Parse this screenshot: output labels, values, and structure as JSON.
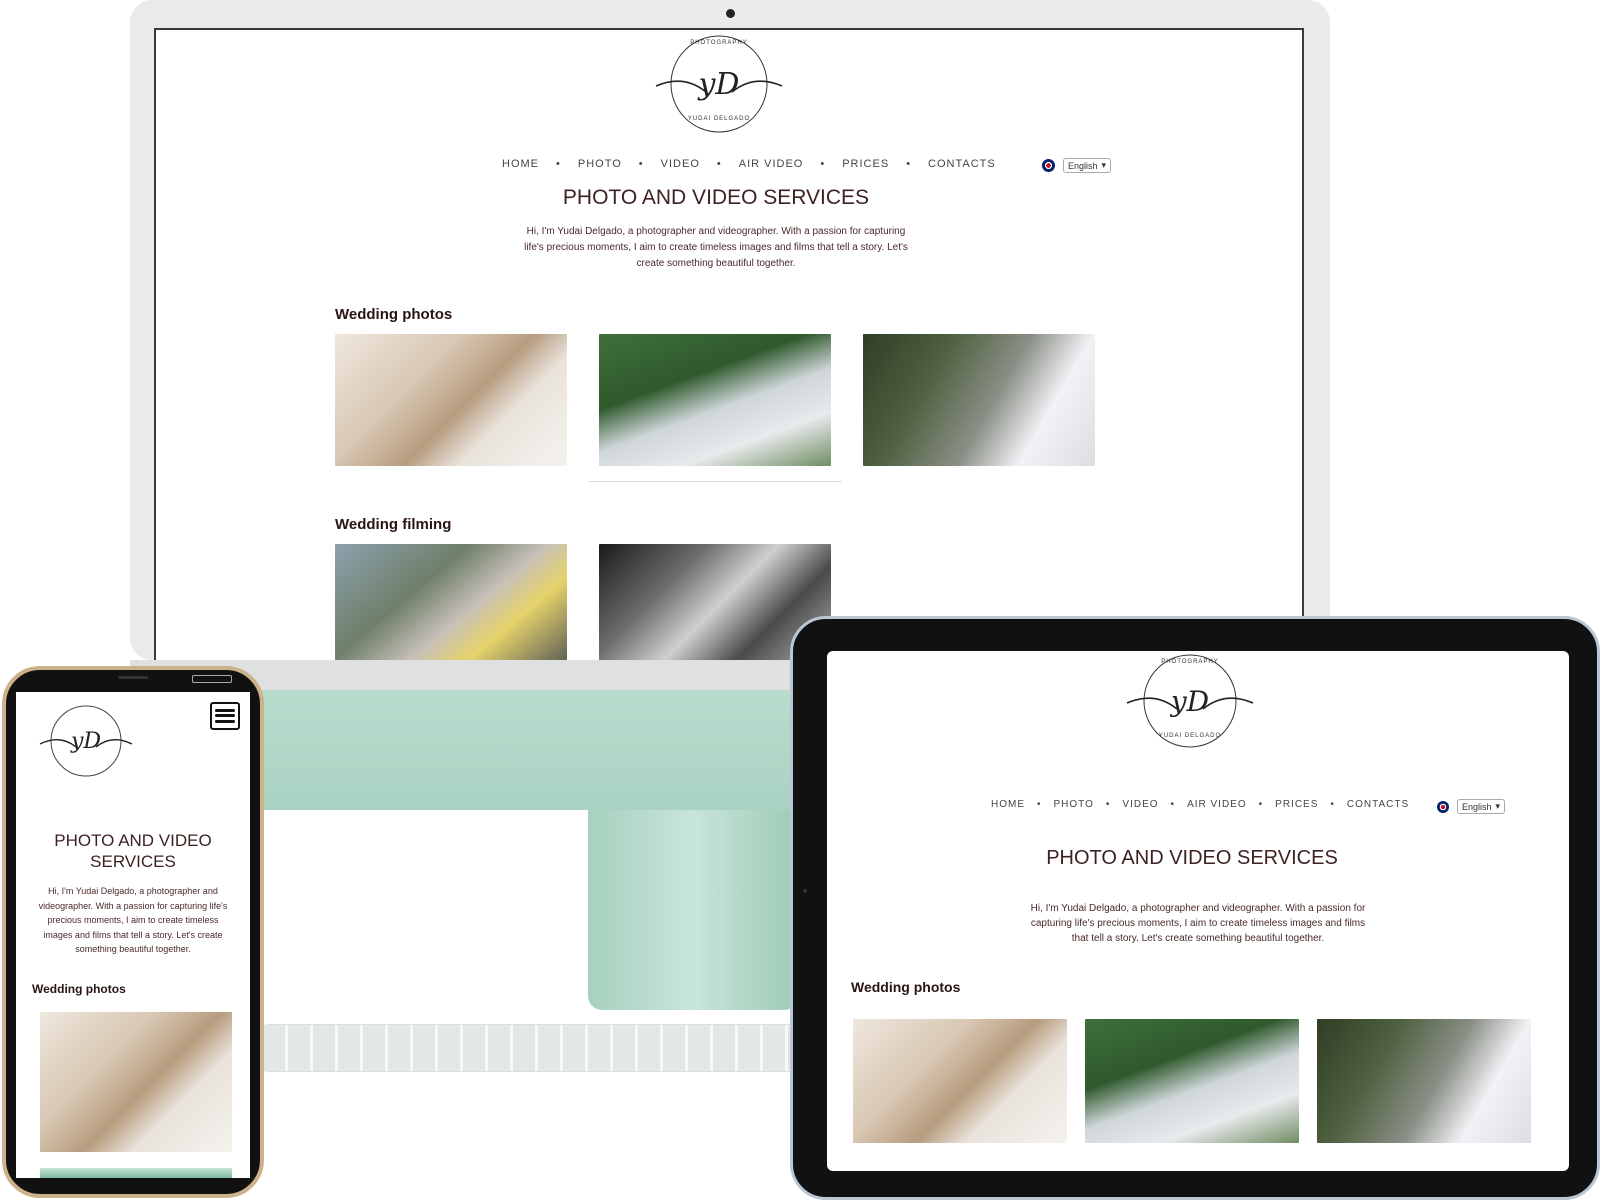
{
  "site": {
    "logo": {
      "monogram": "yD",
      "top_text": "PHOTOGRAPHY",
      "bottom_text": "YUDAI DELGADO"
    },
    "nav": {
      "items": [
        "HOME",
        "PHOTO",
        "VIDEO",
        "AIR VIDEO",
        "PRICES",
        "CONTACTS"
      ],
      "separator": "•"
    },
    "language": {
      "label": "English",
      "icon": "uk-flag-icon",
      "chevron": "▾"
    },
    "title": "PHOTO AND VIDEO SERVICES",
    "intro": "Hi, I'm Yudai Delgado, a photographer and videographer. With a passion for capturing life's precious moments, I aim to create timeless images and films that tell a story. Let's create something beautiful together.",
    "sections": {
      "wedding_photos": "Wedding photos",
      "wedding_filming": "Wedding filming"
    }
  },
  "colors": {
    "monitor_stand": "#a9d2c2",
    "phone_frame": "#cbb28a",
    "tablet_frame": "#b9c6d4",
    "title_text": "#3d2222"
  }
}
